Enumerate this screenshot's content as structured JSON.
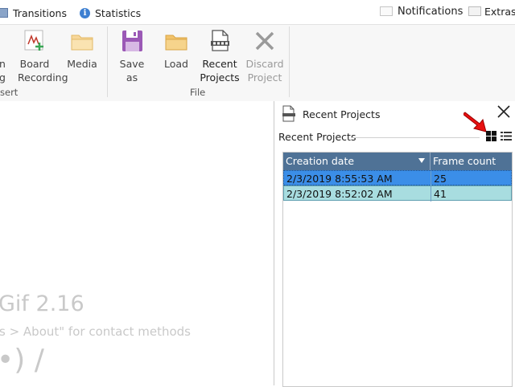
{
  "tabs": {
    "transitions": "Transitions",
    "statistics": "Statistics"
  },
  "top_right": {
    "notifications": "Notifications",
    "extras": "Extras"
  },
  "ribbon": {
    "partial_button": {
      "line1": "n",
      "line2": "g"
    },
    "board_recording": {
      "line1": "Board",
      "line2": "Recording"
    },
    "media": "Media",
    "insert_group": "sert",
    "save_as": "Save as",
    "load": "Load",
    "recent_projects": {
      "line1": "Recent",
      "line2": "Projects"
    },
    "discard_project": {
      "line1": "Discard",
      "line2": "Project"
    },
    "file_group": "File"
  },
  "background_text": {
    "version": "Gif 2.16",
    "contact": "s > About\" for contact methods",
    "emoticon": "•) /"
  },
  "panel": {
    "title": "Recent Projects",
    "section_label": "Recent Projects",
    "columns": {
      "creation_date": "Creation date",
      "frame_count": "Frame count"
    },
    "rows": [
      {
        "creation_date": "2/3/2019 8:55:53 AM",
        "frame_count": "25",
        "selected": true
      },
      {
        "creation_date": "2/3/2019 8:52:02 AM",
        "frame_count": "41",
        "selected": false
      }
    ]
  },
  "colors": {
    "grid_header": "#4f7296",
    "selected_row": "#3b8ee8",
    "alt_row": "#a8dde0",
    "arrow": "#e81010"
  }
}
